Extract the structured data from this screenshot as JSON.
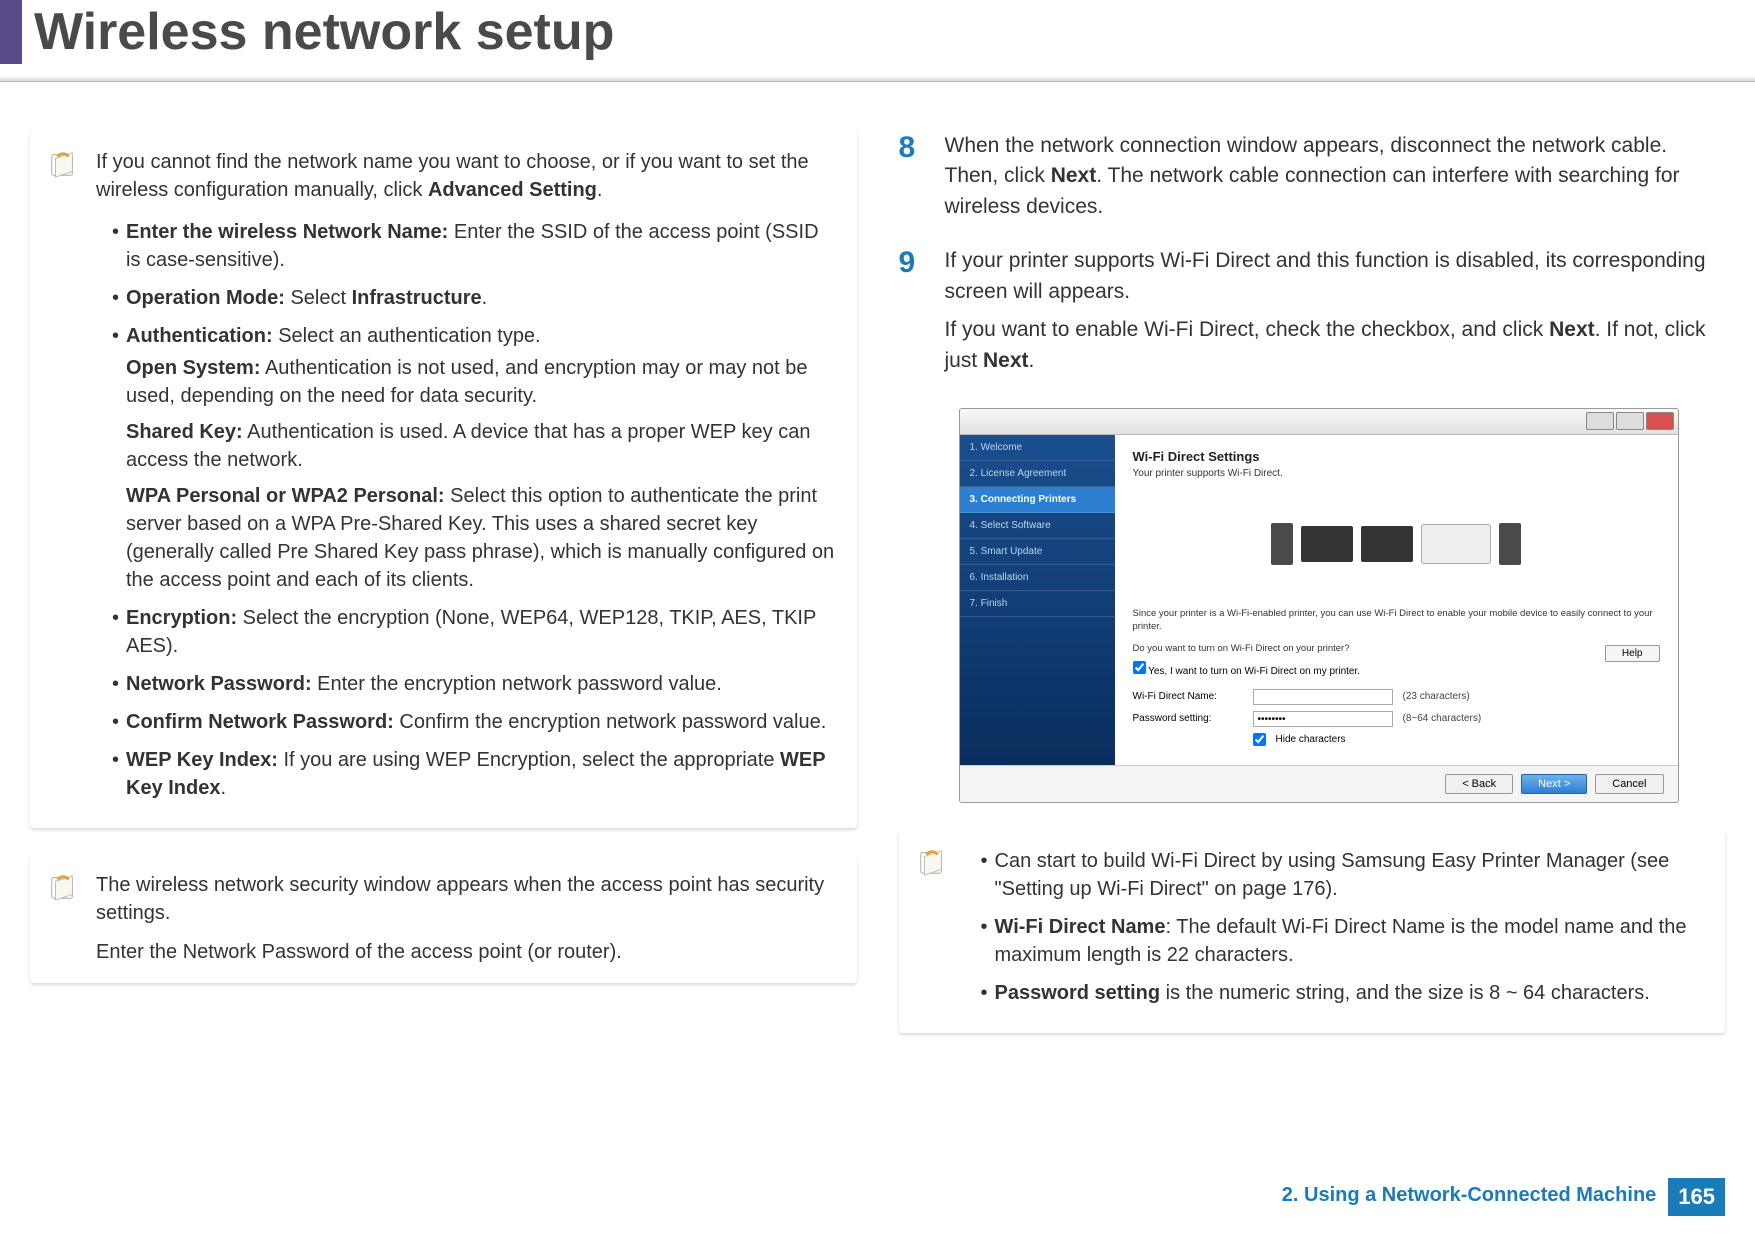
{
  "header": {
    "title": "Wireless network setup"
  },
  "left": {
    "note1": {
      "lead_pre": "If you cannot find the network name you want to choose, or if you want to set the wireless configuration manually, click ",
      "lead_bold": "Advanced Setting",
      "lead_post": ".",
      "items": {
        "ssid_b": "Enter the wireless Network Name:",
        "ssid_t": " Enter the SSID of the access point (SSID is case-sensitive).",
        "op_b": "Operation Mode:",
        "op_t1": " Select ",
        "op_t2": "Infrastructure",
        "op_t3": ".",
        "auth_b": "Authentication:",
        "auth_t": " Select an authentication type.",
        "auth_open_b": "Open System:",
        "auth_open_t": " Authentication is not used, and encryption may or may not be used, depending on the need for data security.",
        "auth_sk_b": "Shared Key:",
        "auth_sk_t": " Authentication is used. A device that has a proper WEP key can access the network.",
        "auth_wpa_b": "WPA Personal or WPA2 Personal:",
        "auth_wpa_t": " Select this option to authenticate the print server based on a WPA Pre-Shared Key. This uses a shared secret key (generally called Pre Shared Key pass phrase), which is manually configured on the access point and each of its clients.",
        "enc_b": "Encryption:",
        "enc_t": " Select the encryption (None, WEP64, WEP128, TKIP, AES, TKIP AES).",
        "np_b": "Network Password:",
        "np_t": " Enter the encryption network password value.",
        "cnp_b": "Confirm Network Password:",
        "cnp_t": " Confirm the encryption network password value.",
        "wep_b": "WEP Key Index:",
        "wep_t1": " If you are using WEP Encryption, select the appropriate ",
        "wep_t2": "WEP Key Index",
        "wep_t3": "."
      }
    },
    "note2": {
      "line1": "The wireless network security window appears when the access point has security settings.",
      "line2": "Enter the Network Password of the access point (or router)."
    }
  },
  "right": {
    "step8": {
      "num": "8",
      "t1": "When the network connection window appears, disconnect the network cable. Then, click ",
      "b1": "Next",
      "t2": ". The network cable connection can interfere with searching for wireless devices."
    },
    "step9": {
      "num": "9",
      "p1": "If your printer supports Wi-Fi Direct and this function is disabled, its corresponding screen will appears.",
      "p2a": " If you want to enable Wi-Fi Direct, check the checkbox, and click ",
      "p2b": "Next",
      "p2c": ". If not, click just ",
      "p2d": "Next",
      "p2e": "."
    },
    "screenshot": {
      "sidebar": [
        "1. Welcome",
        "2. License Agreement",
        "3. Connecting Printers",
        "4. Select Software",
        "5. Smart Update",
        "6. Installation",
        "7. Finish"
      ],
      "active_index": 2,
      "h": "Wi-Fi Direct Settings",
      "sub": "Your printer supports Wi-Fi Direct.",
      "desc": "Since your printer is a Wi-Fi-enabled printer, you can use Wi-Fi Direct to enable your mobile device to easily connect to your printer.",
      "q": "Do you want to turn on Wi-Fi Direct on your printer?",
      "check_label": "Yes, I want to turn on Wi-Fi Direct on my printer.",
      "help": "Help",
      "name_lbl": "Wi-Fi Direct Name:",
      "name_hint": "(23 characters)",
      "pwd_lbl": "Password setting:",
      "pwd_val": "••••••••",
      "pwd_hint": "(8~64 characters)",
      "hide_label": "Hide characters",
      "btn_back": "< Back",
      "btn_next": "Next >",
      "btn_cancel": "Cancel"
    },
    "note3": {
      "line1a": "Can start to build Wi-Fi Direct by using ",
      "line1b": "Samsung Easy Printer Manager",
      "line1c": " (see ",
      "line1d": "\"Setting up Wi-Fi Direct\" on page 176).",
      "wfd_b": "Wi-Fi Direct Name",
      "wfd_t": ": The default Wi-Fi Direct Name is the model name and the maximum length is 22 characters.",
      "pwd_b": "Password setting",
      "pwd_t": " is the numeric string, and the size is 8 ~ 64 characters."
    }
  },
  "footer": {
    "chapter": "2.  Using a Network-Connected Machine",
    "page": "165"
  }
}
